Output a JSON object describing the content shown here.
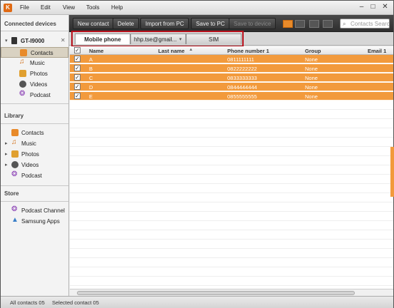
{
  "menu": [
    "File",
    "Edit",
    "View",
    "Tools",
    "Help"
  ],
  "app_icon_text": "K",
  "window_controls": {
    "minimize": "–",
    "maximize": "□",
    "close": "✕"
  },
  "sidebar": {
    "connected_title": "Connected devices",
    "device_name": "GT-I9000",
    "device_items": [
      "Contacts",
      "Music",
      "Photos",
      "Videos",
      "Podcast"
    ],
    "library_title": "Library",
    "library_items": [
      "Contacts",
      "Music",
      "Photos",
      "Videos",
      "Podcast"
    ],
    "store_title": "Store",
    "store_items": [
      "Podcast Channel",
      "Samsung Apps"
    ]
  },
  "toolbar": {
    "new_contact": "New contact",
    "delete": "Delete",
    "import": "Import from PC",
    "save_pc": "Save to PC",
    "save_device": "Save to device",
    "search_placeholder": "Contacts Search"
  },
  "tabs": {
    "mobile": "Mobile phone",
    "account": "hhp.tse@gmail...",
    "sim": "SIM"
  },
  "table": {
    "headers": [
      "Name",
      "Last name",
      "Phone number 1",
      "Group",
      "Email 1"
    ],
    "rows": [
      {
        "name": "A",
        "last": "",
        "phone": "0811111111",
        "group": "None"
      },
      {
        "name": "B",
        "last": "",
        "phone": "0822222222",
        "group": "None"
      },
      {
        "name": "C",
        "last": "",
        "phone": "0833333333",
        "group": "None"
      },
      {
        "name": "D",
        "last": "",
        "phone": "0844444444",
        "group": "None"
      },
      {
        "name": "E",
        "last": "",
        "phone": "0855555555",
        "group": "None"
      }
    ]
  },
  "status": {
    "all": "All contacts 05",
    "selected": "Selected contact 05"
  },
  "colors": {
    "accent": "#f29a3c",
    "highlight_box": "#b8101b",
    "toolbar": "#3a3a3a"
  }
}
